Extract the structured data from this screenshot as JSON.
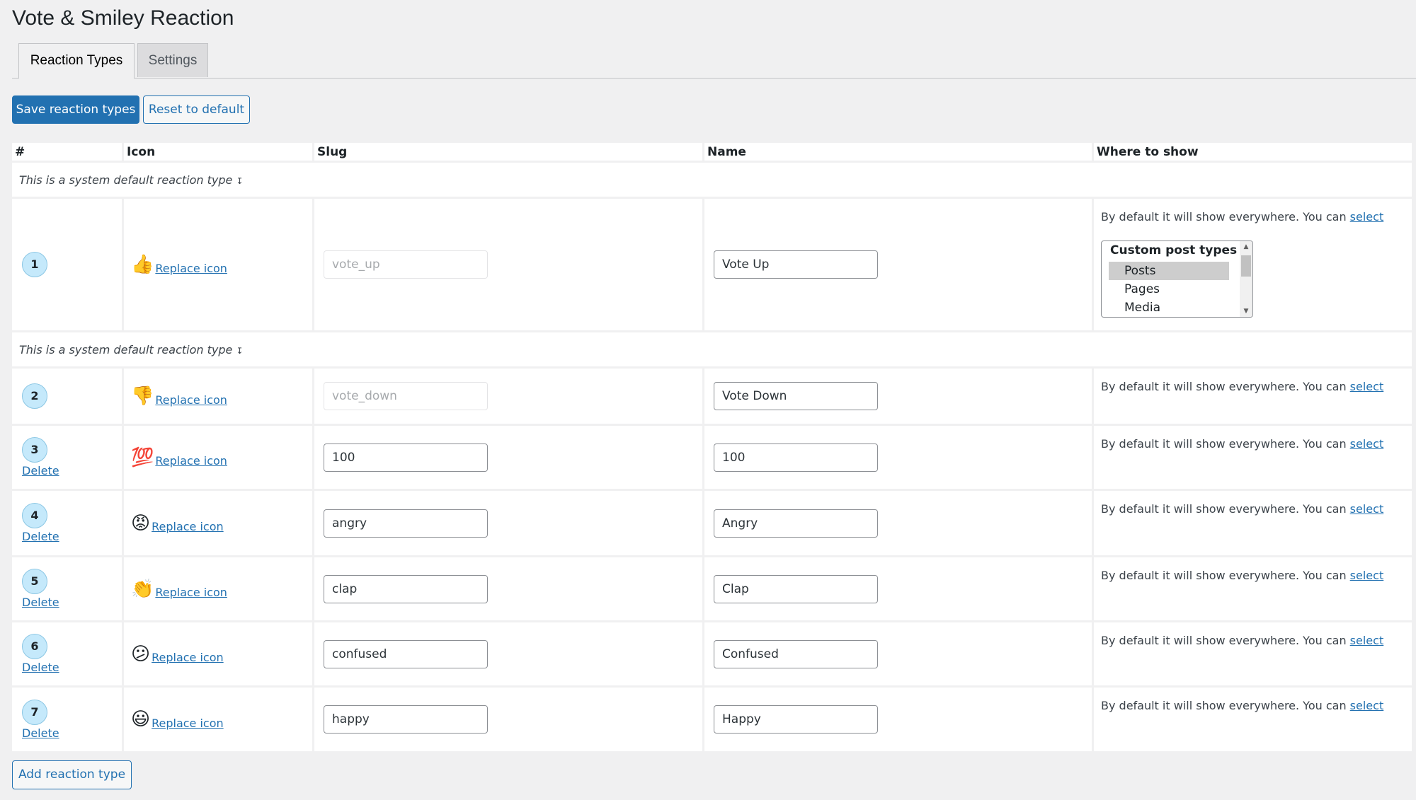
{
  "page": {
    "title": "Vote & Smiley Reaction"
  },
  "tabs": [
    {
      "label": "Reaction Types",
      "active": true
    },
    {
      "label": "Settings",
      "active": false
    }
  ],
  "toolbar": {
    "save_label": "Save reaction types",
    "reset_label": "Reset to default"
  },
  "table": {
    "headers": {
      "num": "#",
      "icon": "Icon",
      "slug": "Slug",
      "name": "Name",
      "where": "Where to show"
    },
    "system_default_note": "This is a system default reaction type",
    "system_default_glyph": "↧",
    "replace_label": "Replace icon",
    "delete_label": "Delete",
    "where_text": "By default it will show everywhere. You can ",
    "where_link": "select",
    "listbox": {
      "group_label": "Custom post types",
      "options": [
        "Posts",
        "Pages",
        "Media"
      ],
      "selected": "Posts"
    },
    "rows": [
      {
        "num": "1",
        "icon": "thumbs-up",
        "emoji": "👍",
        "slug": "vote_up",
        "slug_disabled": true,
        "name": "Vote Up",
        "system": true,
        "deletable": false
      },
      {
        "num": "2",
        "icon": "thumbs-down",
        "emoji": "👎",
        "slug": "vote_down",
        "slug_disabled": true,
        "name": "Vote Down",
        "system": true,
        "deletable": false
      },
      {
        "num": "3",
        "icon": "hundred-points",
        "emoji": "💯",
        "slug": "100",
        "slug_disabled": false,
        "name": "100",
        "system": false,
        "deletable": true
      },
      {
        "num": "4",
        "icon": "angry-face",
        "emoji": "😡",
        "slug": "angry",
        "slug_disabled": false,
        "name": "Angry",
        "system": false,
        "deletable": true
      },
      {
        "num": "5",
        "icon": "clapping-hands",
        "emoji": "👏",
        "slug": "clap",
        "slug_disabled": false,
        "name": "Clap",
        "system": false,
        "deletable": true
      },
      {
        "num": "6",
        "icon": "confused-face",
        "emoji": "😕",
        "slug": "confused",
        "slug_disabled": false,
        "name": "Confused",
        "system": false,
        "deletable": true
      },
      {
        "num": "7",
        "icon": "grinning-face",
        "emoji": "😃",
        "slug": "happy",
        "slug_disabled": false,
        "name": "Happy",
        "system": false,
        "deletable": true
      }
    ]
  },
  "footer": {
    "add_label": "Add reaction type"
  },
  "colors": {
    "accent": "#2271b1",
    "badge_bg": "#c5e9fb",
    "page_bg": "#f0f0f1"
  }
}
